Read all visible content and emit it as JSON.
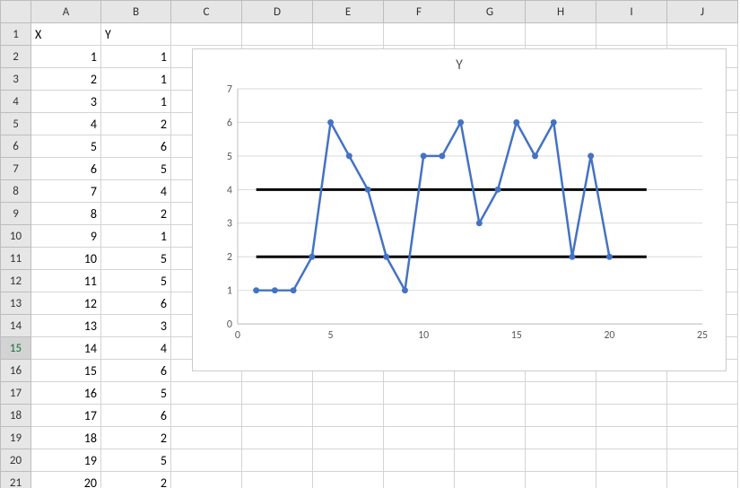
{
  "columns": [
    "A",
    "B",
    "C",
    "D",
    "E",
    "F",
    "G",
    "H",
    "I",
    "J"
  ],
  "rows": 21,
  "headers": {
    "A": "X",
    "B": "Y"
  },
  "table": {
    "A": [
      1,
      2,
      3,
      4,
      5,
      6,
      7,
      8,
      9,
      10,
      11,
      12,
      13,
      14,
      15,
      16,
      17,
      18,
      19,
      20
    ],
    "B": [
      1,
      1,
      1,
      2,
      6,
      5,
      4,
      2,
      1,
      5,
      5,
      6,
      3,
      4,
      6,
      5,
      6,
      2,
      5,
      2
    ]
  },
  "selected_row_header": 15,
  "chart_data": {
    "type": "line",
    "title": "Y",
    "xlabel": "",
    "ylabel": "",
    "xlim": [
      0,
      25
    ],
    "ylim": [
      0,
      7
    ],
    "xticks": [
      0,
      5,
      10,
      15,
      20,
      25
    ],
    "yticks": [
      0,
      1,
      2,
      3,
      4,
      5,
      6,
      7
    ],
    "x": [
      1,
      2,
      3,
      4,
      5,
      6,
      7,
      8,
      9,
      10,
      11,
      12,
      13,
      14,
      15,
      16,
      17,
      18,
      19,
      20
    ],
    "y": [
      1,
      1,
      1,
      2,
      6,
      5,
      4,
      2,
      1,
      5,
      5,
      6,
      3,
      4,
      6,
      5,
      6,
      2,
      5,
      2
    ],
    "series_color": "#4472C4",
    "hlines": [
      {
        "y": 4,
        "x0": 1,
        "x1": 22,
        "color": "#000000",
        "width": 3
      },
      {
        "y": 2,
        "x0": 1,
        "x1": 22,
        "color": "#000000",
        "width": 3
      }
    ]
  }
}
